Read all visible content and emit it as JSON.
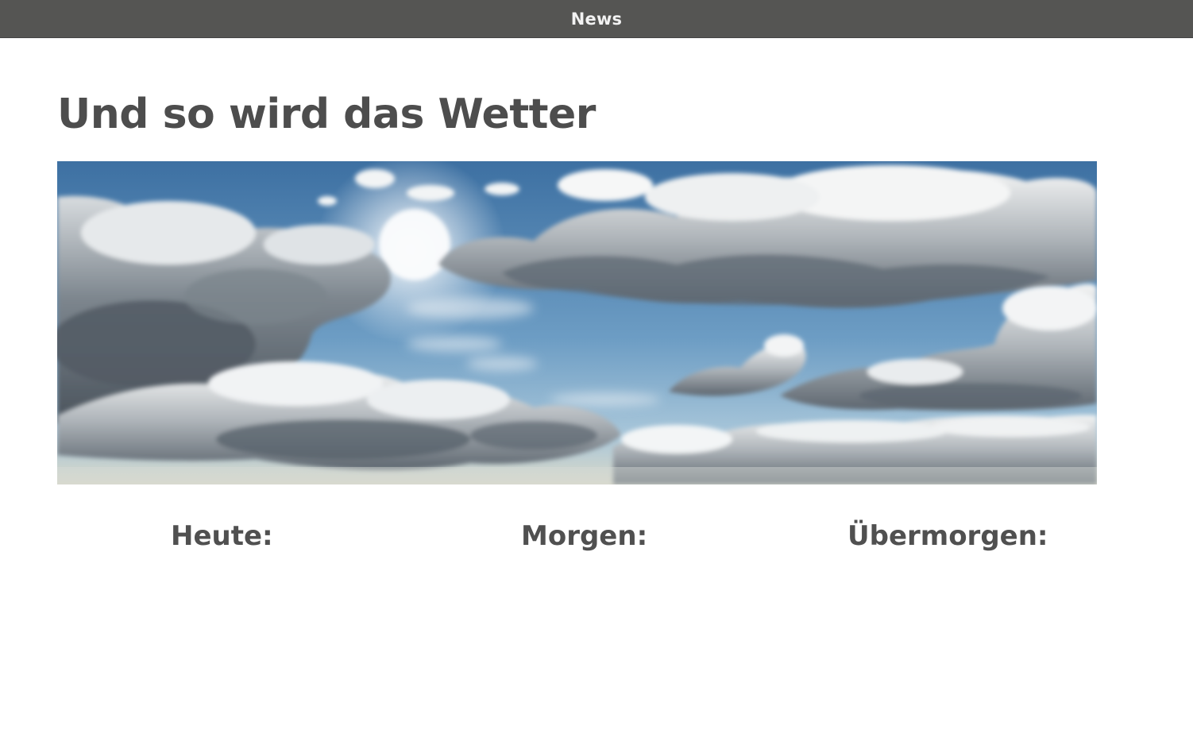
{
  "nav": {
    "title": "News"
  },
  "page": {
    "title": "Und so wird das Wetter"
  },
  "hero_image": {
    "subject": "cloudy-sky-photo"
  },
  "forecast": {
    "days": [
      {
        "label": "Heute:"
      },
      {
        "label": "Morgen:"
      },
      {
        "label": "Übermorgen:"
      }
    ]
  },
  "colors": {
    "topbar": "#555553",
    "text": "#505050",
    "sky_top": "#3f74a6",
    "sky_bottom": "#8fb8d3"
  }
}
